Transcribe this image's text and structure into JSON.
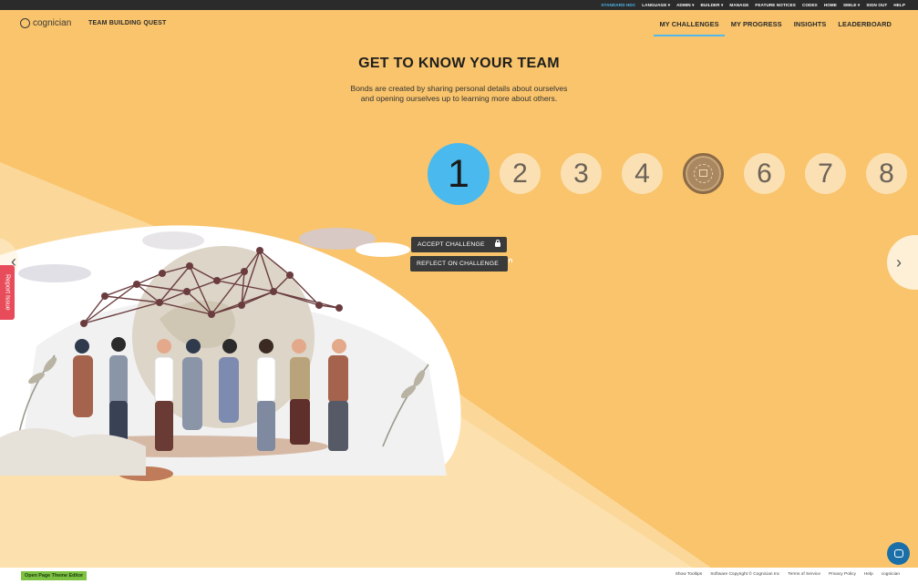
{
  "topbar": {
    "items": [
      "STANDARD HDC",
      "LANGUAGE ▾",
      "ADMIN ▾",
      "BUILDER ▾",
      "MANAGE",
      "FEATURE NOTICES",
      "CODEX",
      "HOME",
      "SMILE ▾",
      "SIGN OUT",
      "HELP"
    ]
  },
  "nav": {
    "logo_text": "cognician",
    "quest_title": "TEAM BUILDING QUEST",
    "tabs": [
      "MY CHALLENGES",
      "MY PROGRESS",
      "INSIGHTS",
      "LEADERBOARD"
    ]
  },
  "page": {
    "title": "GET TO KNOW YOUR TEAM",
    "description": "Bonds are created by sharing personal details about ourselves and opening ourselves up to learning more about others."
  },
  "steps": {
    "s1": "1",
    "s2": "2",
    "s3": "3",
    "s4": "4",
    "s6": "6",
    "s7": "7",
    "s8": "8"
  },
  "actions": {
    "accept": "ACCEPT CHALLENGE",
    "reflect": "REFLECT ON CHALLENGE"
  },
  "report_issue": "Report Issue",
  "footer": {
    "theme_editor": "Open Page Theme Editor",
    "links": [
      "Show Tooltips",
      "Software Copyright © Cognician Inc",
      "Terms of Service",
      "Privacy Policy",
      "Help",
      "cognician"
    ]
  },
  "colors": {
    "background": "#f9c46b",
    "accent": "#4ab9ee",
    "step_inactive": "#fbe0b4",
    "button_dark": "#3a3a3a",
    "report": "#e84b5a",
    "theme_button": "#7dc242"
  }
}
